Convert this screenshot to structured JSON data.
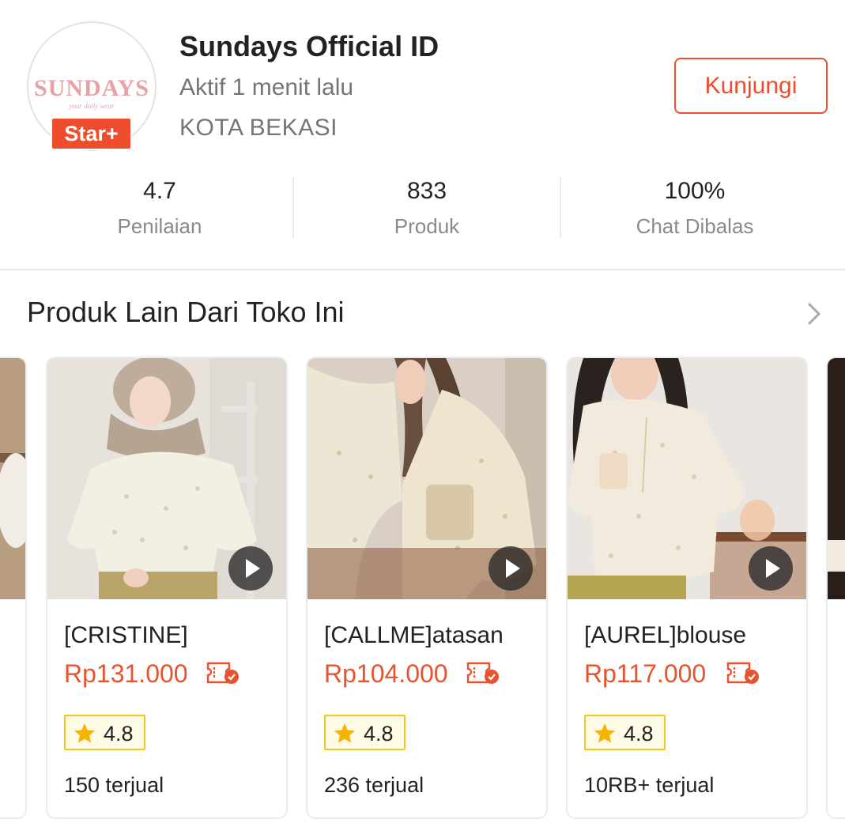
{
  "shop": {
    "avatar_text": "SUNDAYS",
    "avatar_tagline": "your daily wear",
    "badge": "Star+",
    "name": "Sundays Official ID",
    "active_status": "Aktif 1 menit lalu",
    "location": "KOTA BEKASI",
    "visit_label": "Kunjungi"
  },
  "stats": [
    {
      "value": "4.7",
      "label": "Penilaian"
    },
    {
      "value": "833",
      "label": "Produk"
    },
    {
      "value": "100%",
      "label": "Chat Dibalas"
    }
  ],
  "section": {
    "title": "Produk Lain Dari Toko Ini"
  },
  "products": [
    {
      "title": "[CRISTINE]",
      "price": "Rp131.000",
      "rating": "4.8",
      "sold": "150 terjual"
    },
    {
      "title": "[CALLME]atasan",
      "price": "Rp104.000",
      "rating": "4.8",
      "sold": "236 terjual"
    },
    {
      "title": "[AUREL]blouse",
      "price": "Rp117.000",
      "rating": "4.8",
      "sold": "10RB+ terjual"
    }
  ],
  "colors": {
    "brand": "#ee4d2d",
    "price": "#e8532f",
    "muted": "#757575",
    "rating_star": "#f5b400"
  },
  "icons": [
    "chevron-right-icon",
    "play-icon",
    "voucher-icon",
    "star-icon"
  ]
}
